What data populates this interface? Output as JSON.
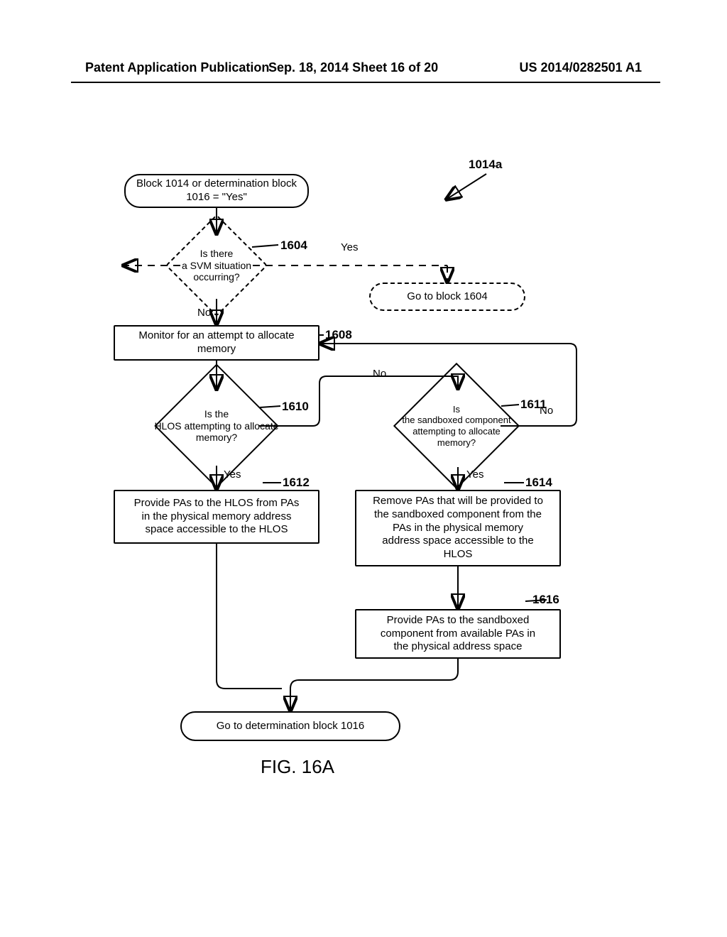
{
  "header": {
    "left": "Patent Application Publication",
    "mid": "Sep. 18, 2014  Sheet 16 of 20",
    "right": "US 2014/0282501 A1"
  },
  "fig_title": "FIG. 16A",
  "pointer_1014a": "1014a",
  "shapes": {
    "start": {
      "text": "Block 1014 or determination block\n1016 = \"Yes\""
    },
    "d1604": {
      "text": "Is there\na SVM situation\n occurring?",
      "ref": "1604",
      "yes": "Yes",
      "no": "No"
    },
    "goto1604": {
      "text": "Go to block 1604"
    },
    "p1608": {
      "text": "Monitor for an attempt to allocate\nmemory",
      "ref": "1608"
    },
    "d1610": {
      "text": "Is the\nHLOS attempting to allocate\nmemory?",
      "ref": "1610",
      "yes": "Yes",
      "no": "No"
    },
    "d1611": {
      "text": "Is\nthe sandboxed component\nattempting to allocate\nmemory?",
      "ref": "1611",
      "yes": "Yes",
      "no": "No"
    },
    "p1612": {
      "text": "Provide PAs to the HLOS from PAs\nin the physical memory address\nspace accessible to the HLOS",
      "ref": "1612"
    },
    "p1614": {
      "text": "Remove PAs that will be provided to\nthe sandboxed component from the\nPAs in the physical memory\naddress space accessible to the\nHLOS",
      "ref": "1614"
    },
    "p1616": {
      "text": "Provide PAs to the sandboxed\ncomponent from available PAs in\nthe physical address space",
      "ref": "1616"
    },
    "end": {
      "text": "Go to determination block 1016"
    }
  },
  "chart_data": {
    "type": "flowchart",
    "nodes": [
      {
        "id": "start",
        "kind": "terminator",
        "text": "Block 1014 or determination block 1016 = \"Yes\""
      },
      {
        "id": "d1604",
        "kind": "decision",
        "text": "Is there a SVM situation occurring?",
        "ref": "1604",
        "style": "dashed"
      },
      {
        "id": "goto1604",
        "kind": "terminator",
        "text": "Go to block 1604",
        "style": "dashed"
      },
      {
        "id": "p1608",
        "kind": "process",
        "text": "Monitor for an attempt to allocate memory",
        "ref": "1608"
      },
      {
        "id": "d1610",
        "kind": "decision",
        "text": "Is the HLOS attempting to allocate memory?",
        "ref": "1610"
      },
      {
        "id": "d1611",
        "kind": "decision",
        "text": "Is the sandboxed component attempting to allocate memory?",
        "ref": "1611"
      },
      {
        "id": "p1612",
        "kind": "process",
        "text": "Provide PAs to the HLOS from PAs in the physical memory address space accessible to the HLOS",
        "ref": "1612"
      },
      {
        "id": "p1614",
        "kind": "process",
        "text": "Remove PAs that will be provided to the sandboxed component from the PAs in the physical memory address space accessible to the HLOS",
        "ref": "1614"
      },
      {
        "id": "p1616",
        "kind": "process",
        "text": "Provide PAs to the sandboxed component from available PAs in the physical address space",
        "ref": "1616"
      },
      {
        "id": "end",
        "kind": "terminator",
        "text": "Go to determination block 1016"
      }
    ],
    "edges": [
      {
        "from": "start",
        "to": "d1604"
      },
      {
        "from": "d1604",
        "to": "goto1604",
        "label": "Yes",
        "style": "dashed"
      },
      {
        "from": "d1604",
        "to": "p1608",
        "label": "No"
      },
      {
        "from": "p1608",
        "to": "d1610"
      },
      {
        "from": "d1610",
        "to": "d1611",
        "label": "No"
      },
      {
        "from": "d1610",
        "to": "p1612",
        "label": "Yes"
      },
      {
        "from": "d1611",
        "to": "p1614",
        "label": "Yes"
      },
      {
        "from": "d1611",
        "to": "p1608",
        "label": "No",
        "note": "loops back"
      },
      {
        "from": "p1614",
        "to": "p1616"
      },
      {
        "from": "p1612",
        "to": "end"
      },
      {
        "from": "p1616",
        "to": "end"
      }
    ],
    "pointer": {
      "id": "1014a",
      "points_to_region": "flowchart"
    }
  }
}
